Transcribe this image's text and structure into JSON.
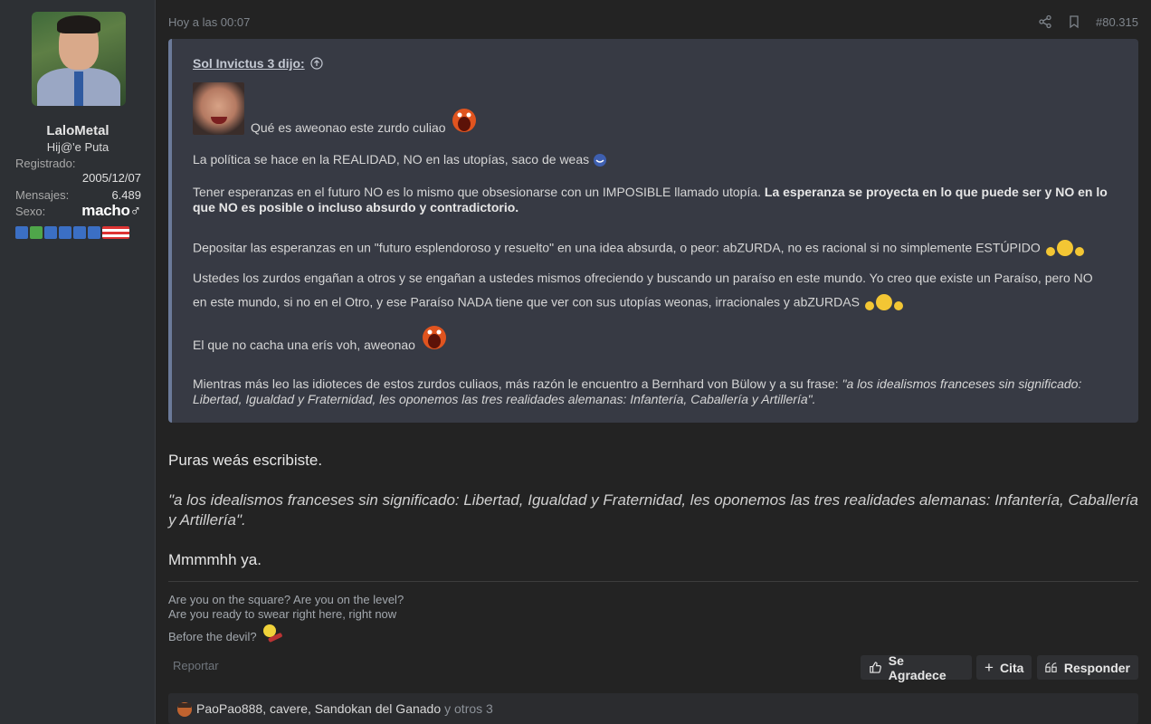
{
  "user": {
    "name": "LaloMetal",
    "title": "Hij@'e Puta",
    "registered_label": "Registrado:",
    "registered_value": "2005/12/07",
    "messages_label": "Mensajes:",
    "messages_value": "6.489",
    "sex_label": "Sexo:",
    "sex_value": "macho♂"
  },
  "post": {
    "time": "Hoy a las 00:07",
    "number": "#80.315"
  },
  "quote": {
    "author": "Sol Invictus 3 dijo:",
    "line1": "Qué es aweonao este zurdo culiao",
    "line2": "La política se hace en la REALIDAD, NO en las utopías, saco de weas",
    "line3_normal": "Tener esperanzas en el futuro NO es lo mismo que obsesionarse con un IMPOSIBLE llamado utopía.",
    "line3_bold": "La esperanza se proyecta en lo que puede ser y NO en lo que NO es posible o incluso absurdo y contradictorio.",
    "line4": "Depositar las esperanzas en un \"futuro esplendoroso y resuelto\" en una idea absurda, o peor: abZURDA, no es racional si no simplemente ESTÚPIDO",
    "line5a": "Ustedes los zurdos engañan a otros y se engañan a ustedes mismos ofreciendo y buscando un paraíso en este mundo. Yo creo que existe un Paraíso, pero NO",
    "line5b": "en este mundo, si no en el Otro, y ese Paraíso NADA tiene que ver con sus utopías weonas, irracionales y abZURDAS",
    "line6": "El que no cacha una erís voh, aweonao",
    "line7_normal": "Mientras más leo las idioteces de estos zurdos culiaos, más razón le encuentro a Bernhard von Bülow y a su frase:",
    "line7_italic": "\"a los idealismos franceses sin significado: Libertad, Igualdad y Fraternidad, les oponemos las tres realidades alemanas: Infantería, Caballería y Artillería\"."
  },
  "body": {
    "p1": "Puras weás escribiste.",
    "p2": "\"a los idealismos franceses sin significado: Libertad, Igualdad y Fraternidad, les oponemos las tres realidades alemanas: Infantería, Caballería y Artillería\".",
    "p3": "Mmmmhh ya."
  },
  "signature": {
    "line1": "Are you on the square? Are you on the level?",
    "line2": "Are you ready to swear right here, right now",
    "line3": "Before the devil?"
  },
  "actions": {
    "report": "Reportar",
    "thanks": "Se Agradece",
    "quote": "Cita",
    "reply": "Responder"
  },
  "reactions": {
    "users": [
      "PaoPao888",
      "cavere",
      "Sandokan del Ganado"
    ],
    "others": "y otros 3"
  },
  "colors": {
    "background": "#232323",
    "sidebar": "#2d3034",
    "quote_bg": "#373a44",
    "quote_border": "#6b7a99"
  }
}
